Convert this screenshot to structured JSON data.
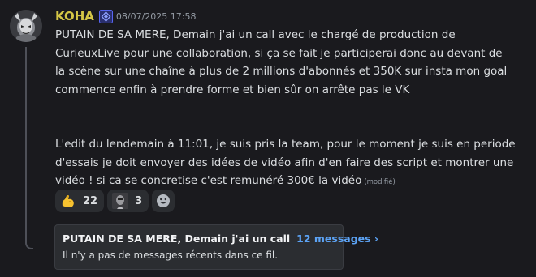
{
  "message": {
    "username": "KOHA",
    "badge_icon": "server-booster-badge-icon",
    "timestamp": "08/07/2025 17:58",
    "paragraph_1": "PUTAIN DE SA MERE, Demain j'ai un call avec le chargé de production de\nCurieuxLive pour une collaboration, si ça se fait je participerai donc au devant de\nla scène sur une chaîne à plus de 2 millions d'abonnés et 350K sur insta mon goal\ncommence enfin à prendre forme et bien sûr on arrête pas le VK",
    "paragraph_2": "L'edit du lendemain à 11:01, je suis pris la team, pour le moment je suis en periode\nd'essais je doit envoyer des idées de vidéo afin d'en faire des script et montrer une\nvidéo ! si ca se concretise c'est remunéré 300€ la vidéo",
    "edited_label": "(modifié)"
  },
  "reactions": [
    {
      "emoji": "flexed-biceps-icon",
      "count": "22"
    },
    {
      "emoji": "custom-face-emoji-icon",
      "count": "3"
    }
  ],
  "add_reaction_icon": "smiley-face-icon",
  "thread": {
    "title": "PUTAIN DE SA MERE, Demain j'ai un call",
    "count_label": "12 messages ›",
    "subtitle": "Il n'y a pas de messages récents dans ce fil."
  },
  "colors": {
    "background": "#1a1a1e",
    "username": "#d4c646",
    "link": "#5ca3f5",
    "reaction_bg": "#2b2d31"
  }
}
